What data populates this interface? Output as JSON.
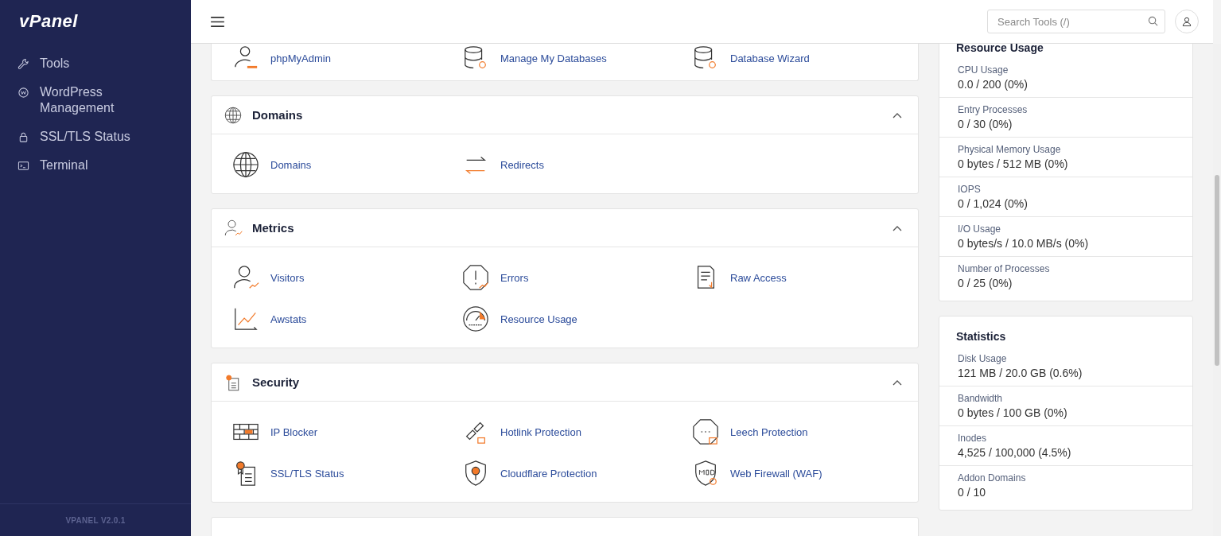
{
  "sidebar": {
    "logo": "vPanel",
    "items": [
      {
        "label": "Tools",
        "kind": "wrench"
      },
      {
        "label": "WordPress Management",
        "kind": "wordpress"
      },
      {
        "label": "SSL/TLS Status",
        "kind": "lock"
      },
      {
        "label": "Terminal",
        "kind": "terminal"
      }
    ],
    "version": "VPANEL V2.0.1"
  },
  "header": {
    "search": {
      "placeholder": "Search Tools (/)"
    }
  },
  "sections": [
    {
      "items": [
        {
          "label": "phpMyAdmin",
          "kind": "php"
        },
        {
          "label": "Manage My Databases",
          "kind": "db-gear"
        },
        {
          "label": "Database Wizard",
          "kind": "db-pin"
        }
      ]
    },
    {
      "title": "Domains",
      "kind": "globe",
      "expanded": true,
      "items": [
        {
          "label": "Domains",
          "kind": "globe"
        },
        {
          "label": "Redirects",
          "kind": "arrows"
        }
      ]
    },
    {
      "title": "Metrics",
      "kind": "person-chart",
      "expanded": true,
      "items": [
        {
          "label": "Visitors",
          "kind": "person-chart"
        },
        {
          "label": "Errors",
          "kind": "error"
        },
        {
          "label": "Raw Access",
          "kind": "doc"
        },
        {
          "label": "Awstats",
          "kind": "chart"
        },
        {
          "label": "Resource Usage",
          "kind": "gauge"
        }
      ]
    },
    {
      "title": "Security",
      "kind": "cert",
      "expanded": true,
      "items": [
        {
          "label": "IP Blocker",
          "kind": "wall"
        },
        {
          "label": "Hotlink Protection",
          "kind": "link"
        },
        {
          "label": "Leech Protection",
          "kind": "octagon-lock"
        },
        {
          "label": "SSL/TLS Status",
          "kind": "cert"
        },
        {
          "label": "Cloudflare Protection",
          "kind": "shield"
        },
        {
          "label": "Web Firewall (WAF)",
          "kind": "mod"
        }
      ]
    }
  ],
  "resource_usage": {
    "title": "Resource Usage",
    "rows": [
      {
        "label": "CPU Usage",
        "value": "0.0 / 200 (0%)"
      },
      {
        "label": "Entry Processes",
        "value": "0 / 30 (0%)"
      },
      {
        "label": "Physical Memory Usage",
        "value": "0 bytes / 512 MB (0%)"
      },
      {
        "label": "IOPS",
        "value": "0 / 1,024 (0%)"
      },
      {
        "label": "I/O Usage",
        "value": "0 bytes/s / 10.0 MB/s (0%)"
      },
      {
        "label": "Number of Processes",
        "value": "0 / 25 (0%)"
      }
    ]
  },
  "statistics": {
    "title": "Statistics",
    "rows": [
      {
        "label": "Disk Usage",
        "value": "121 MB / 20.0 GB (0.6%)"
      },
      {
        "label": "Bandwidth",
        "value": "0 bytes / 100 GB (0%)"
      },
      {
        "label": "Inodes",
        "value": "4,525 / 100,000 (4.5%)"
      },
      {
        "label": "Addon Domains",
        "value": "0 / 10"
      }
    ]
  }
}
